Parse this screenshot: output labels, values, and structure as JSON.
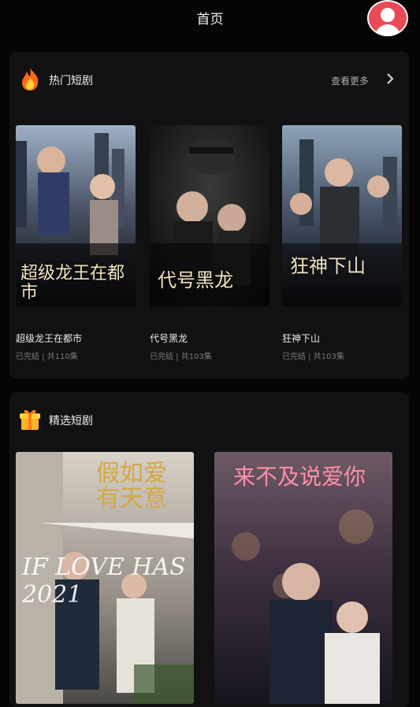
{
  "header": {
    "title": "首页"
  },
  "hot": {
    "title": "热门短剧",
    "more": "查看更多",
    "items": [
      {
        "name": "超级龙王在都市",
        "meta": "已完结 | 共110集",
        "overlay": "超级龙王在都市"
      },
      {
        "name": "代号黑龙",
        "meta": "已完结 | 共103集",
        "overlay": "代号黑龙"
      },
      {
        "name": "狂神下山",
        "meta": "已完结 | 共103集",
        "overlay": "狂神下山"
      }
    ]
  },
  "selected": {
    "title": "精选短剧",
    "items": [
      {
        "overlay": "假如爱有天意",
        "overlay2": "IF LOVE HAS 2021"
      },
      {
        "overlay": "来不及说爱你"
      }
    ]
  }
}
